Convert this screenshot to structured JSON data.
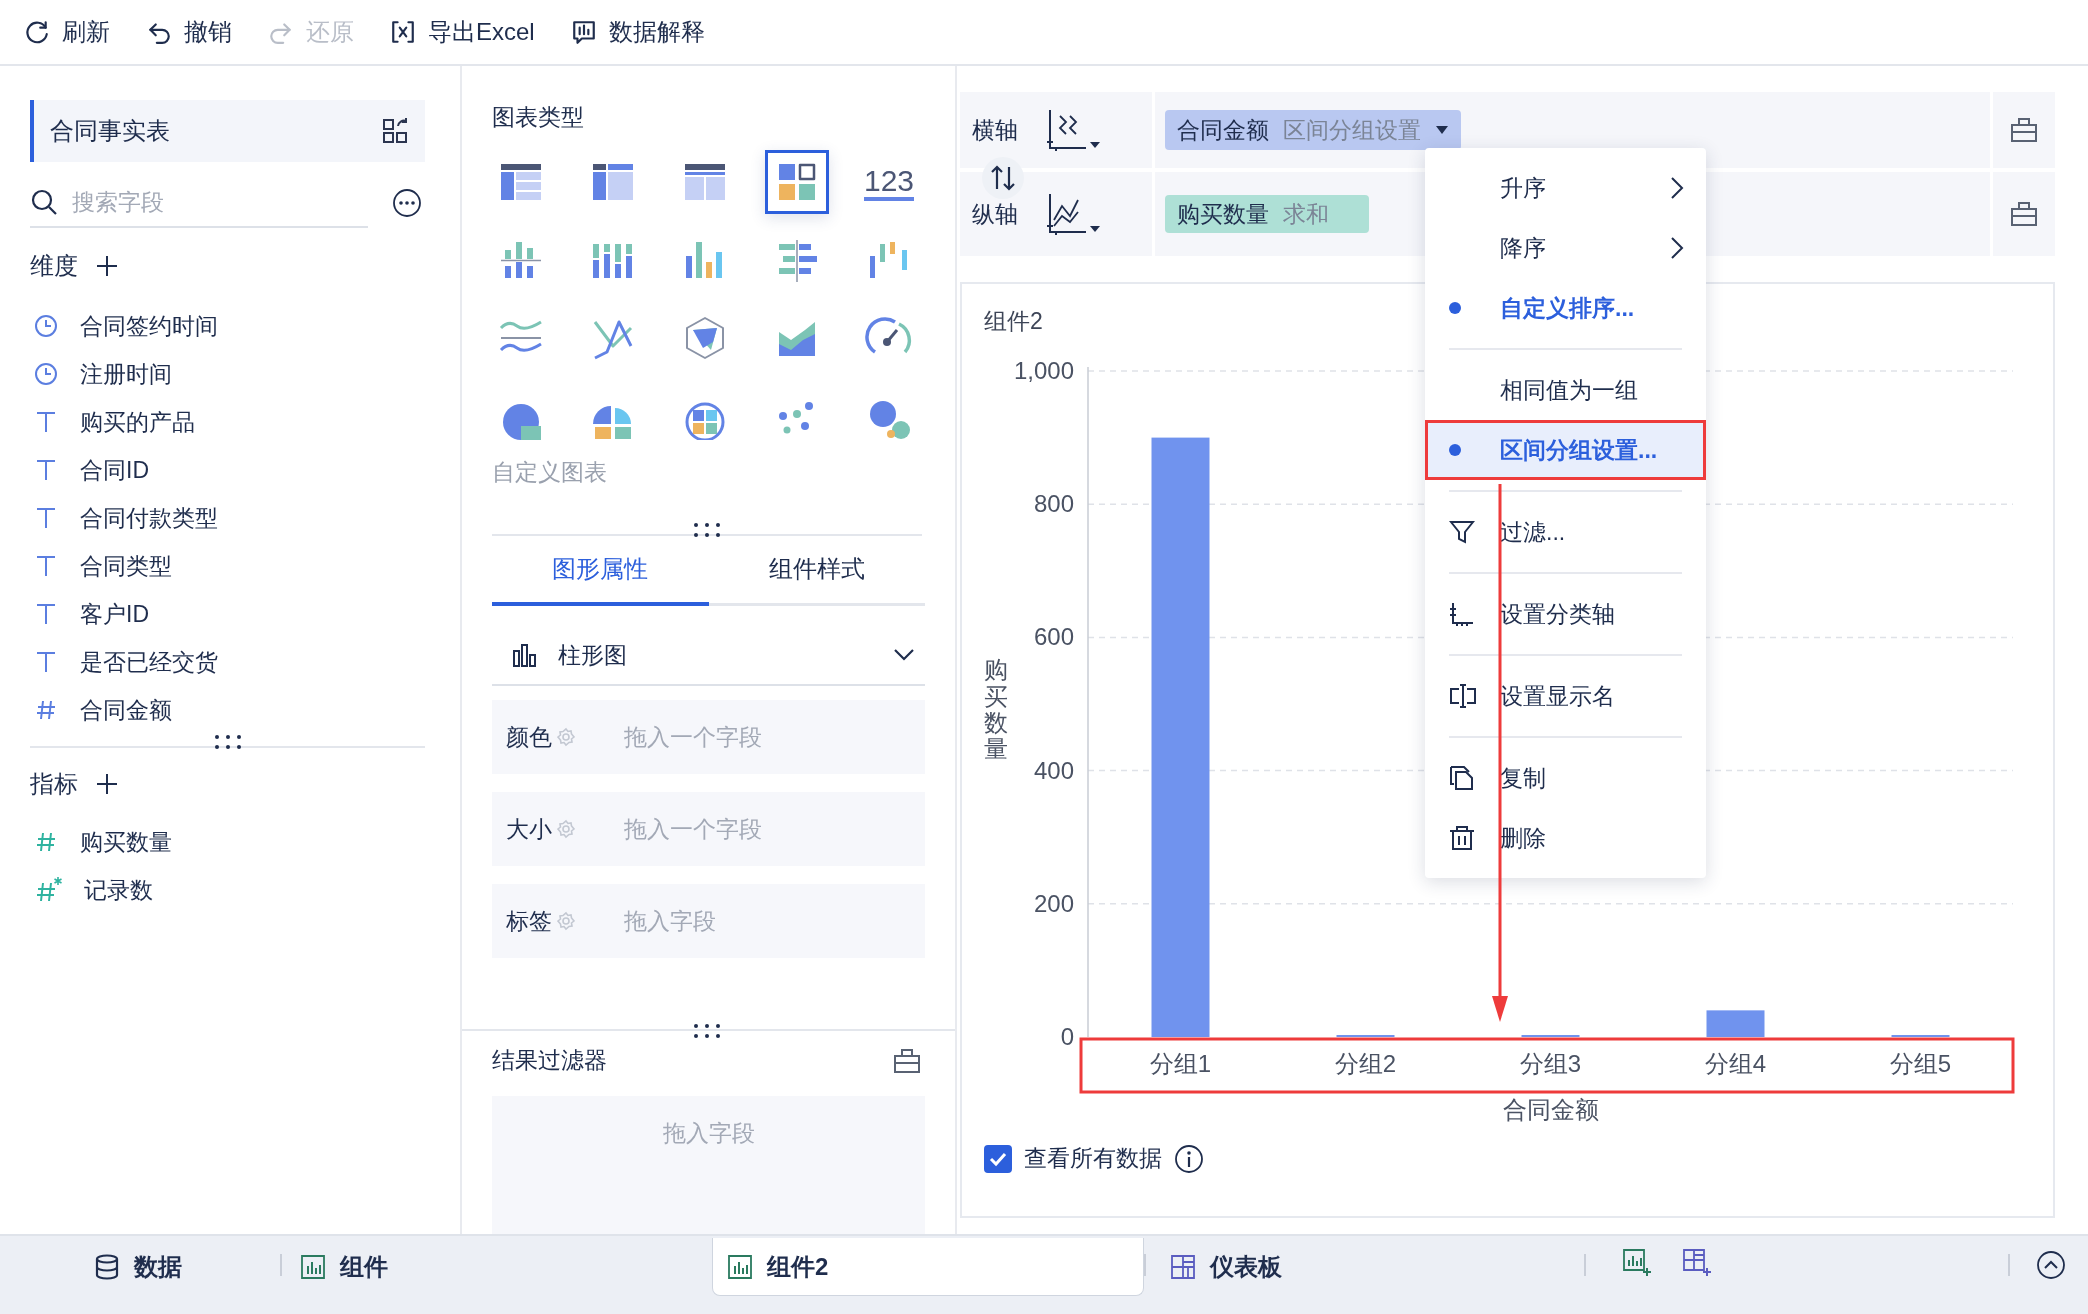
{
  "toolbar": [
    {
      "label": "刷新",
      "kind": "refresh",
      "disabled": false
    },
    {
      "label": "撤销",
      "kind": "undo",
      "disabled": false
    },
    {
      "label": "还原",
      "kind": "redo",
      "disabled": true
    },
    {
      "label": "导出Excel",
      "kind": "excel",
      "disabled": false
    },
    {
      "label": "数据解释",
      "kind": "explain",
      "disabled": false
    }
  ],
  "dataset": {
    "title": "合同事实表"
  },
  "search": {
    "placeholder": "搜索字段"
  },
  "dimensions": {
    "title": "维度",
    "fields": [
      {
        "name": "合同签约时间",
        "kind": "time"
      },
      {
        "name": "注册时间",
        "kind": "time"
      },
      {
        "name": "购买的产品",
        "kind": "text"
      },
      {
        "name": "合同ID",
        "kind": "text"
      },
      {
        "name": "合同付款类型",
        "kind": "text"
      },
      {
        "name": "合同类型",
        "kind": "text"
      },
      {
        "name": "客户ID",
        "kind": "text"
      },
      {
        "name": "是否已经交货",
        "kind": "text"
      },
      {
        "name": "合同金额",
        "kind": "number"
      }
    ]
  },
  "measures": {
    "title": "指标",
    "fields": [
      {
        "name": "购买数量",
        "kind": "number"
      },
      {
        "name": "记录数",
        "kind": "count"
      }
    ]
  },
  "chart_types": {
    "title": "图表类型",
    "custom_label": "自定义图表",
    "items": [
      {
        "kind": "group-table",
        "selected": false
      },
      {
        "kind": "cross-table",
        "selected": false
      },
      {
        "kind": "detail-table",
        "selected": false
      },
      {
        "kind": "treemap",
        "selected": true
      },
      {
        "kind": "kpi",
        "label": "123",
        "selected": false
      },
      {
        "kind": "grouped-bar",
        "selected": false
      },
      {
        "kind": "stacked-bar",
        "selected": false
      },
      {
        "kind": "multi-bar",
        "selected": false
      },
      {
        "kind": "mirror-bar",
        "selected": false
      },
      {
        "kind": "range-bar",
        "selected": false
      },
      {
        "kind": "ribbon-line",
        "selected": false
      },
      {
        "kind": "line",
        "selected": false
      },
      {
        "kind": "radar",
        "selected": false
      },
      {
        "kind": "area",
        "selected": false
      },
      {
        "kind": "gauge",
        "selected": false
      },
      {
        "kind": "pie",
        "selected": false
      },
      {
        "kind": "rose",
        "selected": false
      },
      {
        "kind": "multi-pie",
        "selected": false
      },
      {
        "kind": "scatter",
        "selected": false
      },
      {
        "kind": "bubble",
        "selected": false
      }
    ]
  },
  "property_tabs": [
    {
      "label": "图形属性",
      "selected": true
    },
    {
      "label": "组件样式",
      "selected": false
    }
  ],
  "chart_kind": {
    "label": "柱形图"
  },
  "shelves": [
    {
      "label": "颜色",
      "placeholder": "拖入一个字段"
    },
    {
      "label": "大小",
      "placeholder": "拖入一个字段"
    },
    {
      "label": "标签",
      "placeholder": "拖入字段"
    }
  ],
  "result_filter": {
    "title": "结果过滤器",
    "placeholder": "拖入字段"
  },
  "axes": [
    {
      "label": "横轴",
      "field": "合同金额",
      "summary": "区间分组设置",
      "color": "#b9c8f1",
      "dropdown": true
    },
    {
      "label": "纵轴",
      "field": "购买数量",
      "summary": "求和",
      "color": "#aee0d6",
      "dropdown": false
    }
  ],
  "context_menu": {
    "arrow": true,
    "items": [
      {
        "label": "升序",
        "kind": "submenu",
        "selected": false,
        "highlighted": false,
        "divider_after": false
      },
      {
        "label": "降序",
        "kind": "submenu",
        "selected": false,
        "highlighted": false,
        "divider_after": false
      },
      {
        "label": "自定义排序...",
        "kind": "option",
        "selected": true,
        "highlighted": false,
        "divider_after": true
      },
      {
        "label": "相同值为一组",
        "kind": "option",
        "selected": false,
        "highlighted": false,
        "divider_after": false
      },
      {
        "label": "区间分组设置...",
        "kind": "option",
        "selected": true,
        "highlighted": true,
        "divider_after": true
      },
      {
        "label": "过滤...",
        "kind": "filter",
        "selected": false,
        "highlighted": false,
        "divider_after": true
      },
      {
        "label": "设置分类轴",
        "kind": "axis",
        "selected": false,
        "highlighted": false,
        "divider_after": true
      },
      {
        "label": "设置显示名",
        "kind": "rename",
        "selected": false,
        "highlighted": false,
        "divider_after": true
      },
      {
        "label": "复制",
        "kind": "copy",
        "selected": false,
        "highlighted": false,
        "divider_after": false
      },
      {
        "label": "删除",
        "kind": "delete",
        "selected": false,
        "highlighted": false,
        "divider_after": false
      }
    ]
  },
  "widget": {
    "title": "组件2",
    "axis_highlighted": true,
    "chart_data": {
      "type": "bar",
      "xlabel": "合同金额",
      "ylabel": "购买数量",
      "categories": [
        "分组1",
        "分组2",
        "分组3",
        "分组4",
        "分组5"
      ],
      "series": [
        {
          "color": "#7093ee",
          "values": [
            900,
            0,
            0,
            40,
            0
          ]
        }
      ],
      "grid": true,
      "ylim": [
        0,
        1000
      ],
      "yticks": [
        0,
        200,
        400,
        600,
        800,
        {
          "value": 1000,
          "label": "1,000"
        }
      ]
    },
    "show_all": {
      "label": "查看所有数据",
      "checked": true
    }
  },
  "bottom_tabs": [
    {
      "label": "数据",
      "kind": "data",
      "selected": false
    },
    {
      "label": "组件",
      "kind": "chart",
      "selected": false
    },
    {
      "label": "组件2",
      "kind": "chart",
      "selected": true
    },
    {
      "label": "仪表板",
      "kind": "dashboard",
      "selected": false
    }
  ]
}
